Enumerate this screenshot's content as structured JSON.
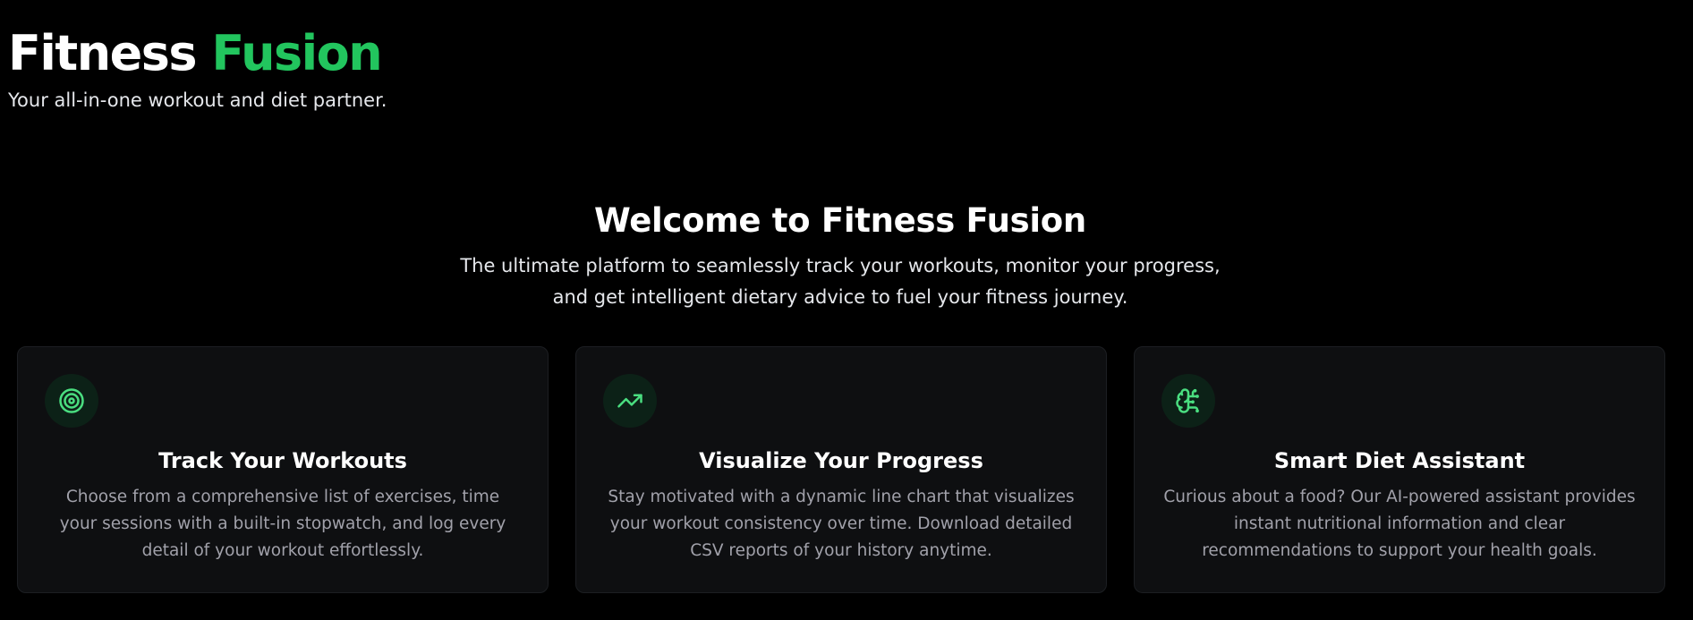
{
  "header": {
    "brand_first": "Fitness",
    "brand_second": "Fusion",
    "tagline": "Your all-in-one workout and diet partner."
  },
  "hero": {
    "title": "Welcome to Fitness Fusion",
    "description": "The ultimate platform to seamlessly track your workouts, monitor your progress, and get intelligent dietary advice to fuel your fitness journey."
  },
  "features": [
    {
      "icon": "target-icon",
      "title": "Track Your Workouts",
      "description": "Choose from a comprehensive list of exercises, time your sessions with a built-in stopwatch, and log every detail of your workout effortlessly."
    },
    {
      "icon": "trending-up-icon",
      "title": "Visualize Your Progress",
      "description": "Stay motivated with a dynamic line chart that visualizes your workout consistency over time. Download detailed CSV reports of your history anytime."
    },
    {
      "icon": "brain-icon",
      "title": "Smart Diet Assistant",
      "description": "Curious about a food? Our AI-powered assistant provides instant nutritional information and clear recommendations to support your health goals."
    }
  ],
  "colors": {
    "background": "#000000",
    "accent": "#22c55e",
    "card_background": "#0e0f11",
    "icon_background": "#0c2117",
    "muted_text": "#a1a1aa"
  }
}
